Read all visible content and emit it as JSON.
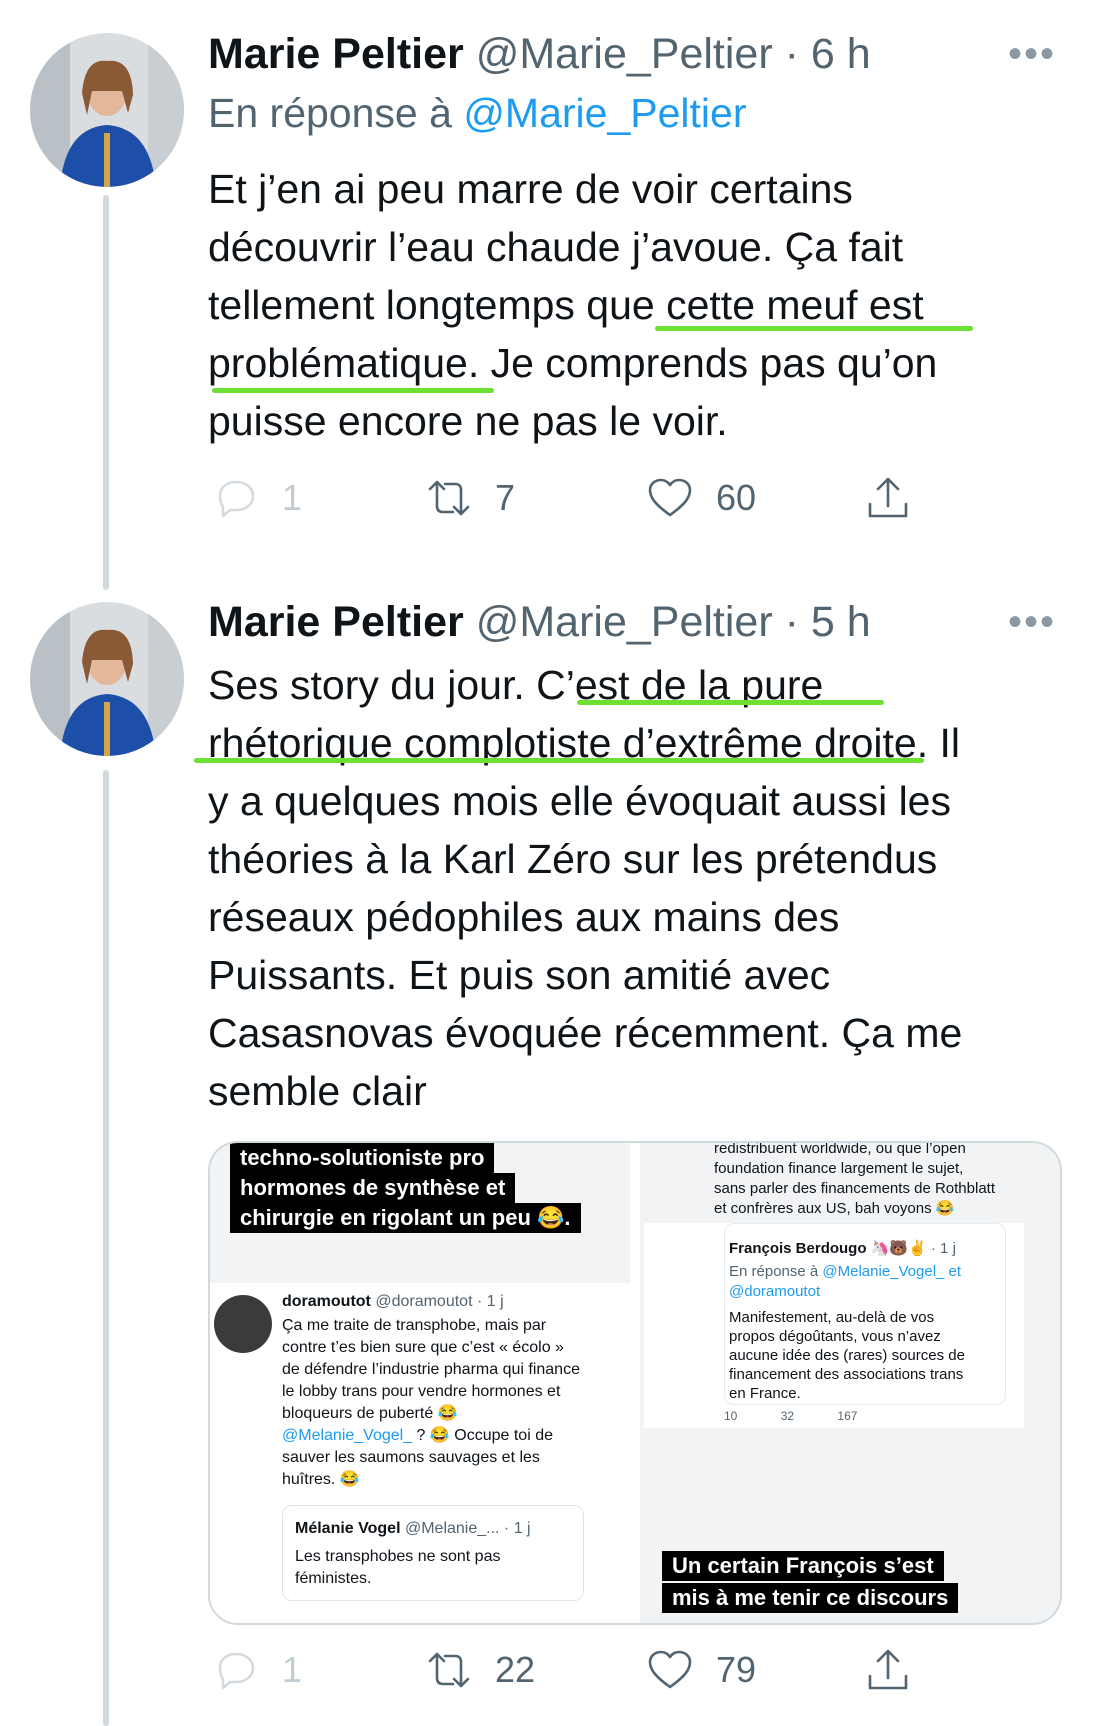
{
  "tweets": [
    {
      "name": "Marie Peltier",
      "handle": "@Marie_Peltier",
      "time": "· 6 h",
      "reply_prefix": "En réponse à",
      "reply_mention": "@Marie_Peltier",
      "text": "Et j’en ai peu marre de voir certains\ndécouvrir l’eau chaude j’avoue. Ça fait\ntellement longtemps que cette meuf est\nproblématique. Je comprends pas qu’on\npuisse encore ne pas le voir.",
      "replies": "1",
      "retweets": "7",
      "likes": "60"
    },
    {
      "name": "Marie Peltier",
      "handle": "@Marie_Peltier",
      "time": "· 5 h",
      "text": "Ses story du jour. C’est de la pure\nrhétorique complotiste d’extrême droite. Il\ny a quelques mois elle évoquait aussi les\nthéories à la Karl Zéro sur les prétendus\nréseaux pédophiles aux mains des\nPuissants. Et puis son amitié avec\nCasasnovas évoquée récemment. Ça me\nsemble clair",
      "replies": "1",
      "retweets": "22",
      "likes": "79"
    }
  ],
  "more_icon": "•••",
  "media": {
    "left": {
      "caption_lines": [
        "techno-solutioniste pro",
        "hormones de synthèse et",
        "chirurgie en rigolant un peu 😂."
      ],
      "embedded": {
        "name": "doramoutot",
        "handle": "@doramoutot · 1 j",
        "text_lines": [
          "Ça me traite de transphobe, mais par",
          "contre t’es bien sure que c’est « écolo »",
          "de défendre l’industrie pharma qui finance",
          "le lobby trans pour vendre hormones et",
          "bloqueurs de puberté 😂"
        ],
        "mention": "@Melanie_Vogel_",
        "text_after": " ? 😂 Occupe toi de",
        "text_lines2": [
          "sauver les saumons sauvages et les",
          "huîtres. 😂"
        ],
        "quoted_name": "Mélanie Vogel",
        "quoted_handle": "@Melanie_... · 1 j",
        "quoted_text_lines": [
          "Les transphobes ne sont pas",
          "féministes."
        ]
      }
    },
    "right": {
      "top_text_lines": [
        "redistribuent worldwide, ou que l’open",
        "foundation finance largement le sujet,",
        "sans parler des financements de Rothblatt",
        "et confrères aux US, bah voyons 😂"
      ],
      "embedded": {
        "name": "François Berdougo 🦄🐻✌",
        "time": "· 1 j",
        "reply_prefix": "En réponse à",
        "reply_mentions": "@Melanie_Vogel_ et",
        "reply_mentions2": "@doramoutot",
        "text_lines": [
          "Manifestement, au-delà de vos",
          "propos dégoûtants, vous n’avez",
          "aucune idée des (rares) sources de",
          "financement des associations trans",
          "en France."
        ],
        "replies": "10",
        "retweets": "32",
        "likes": "167"
      },
      "caption_lines": [
        "Un certain François s’est",
        "mis à me tenir ce discours"
      ]
    }
  },
  "colors": {
    "highlight": "#6ce134",
    "link": "#1d9bf0",
    "secondary": "#536471",
    "thread_line": "#cfd9de"
  }
}
